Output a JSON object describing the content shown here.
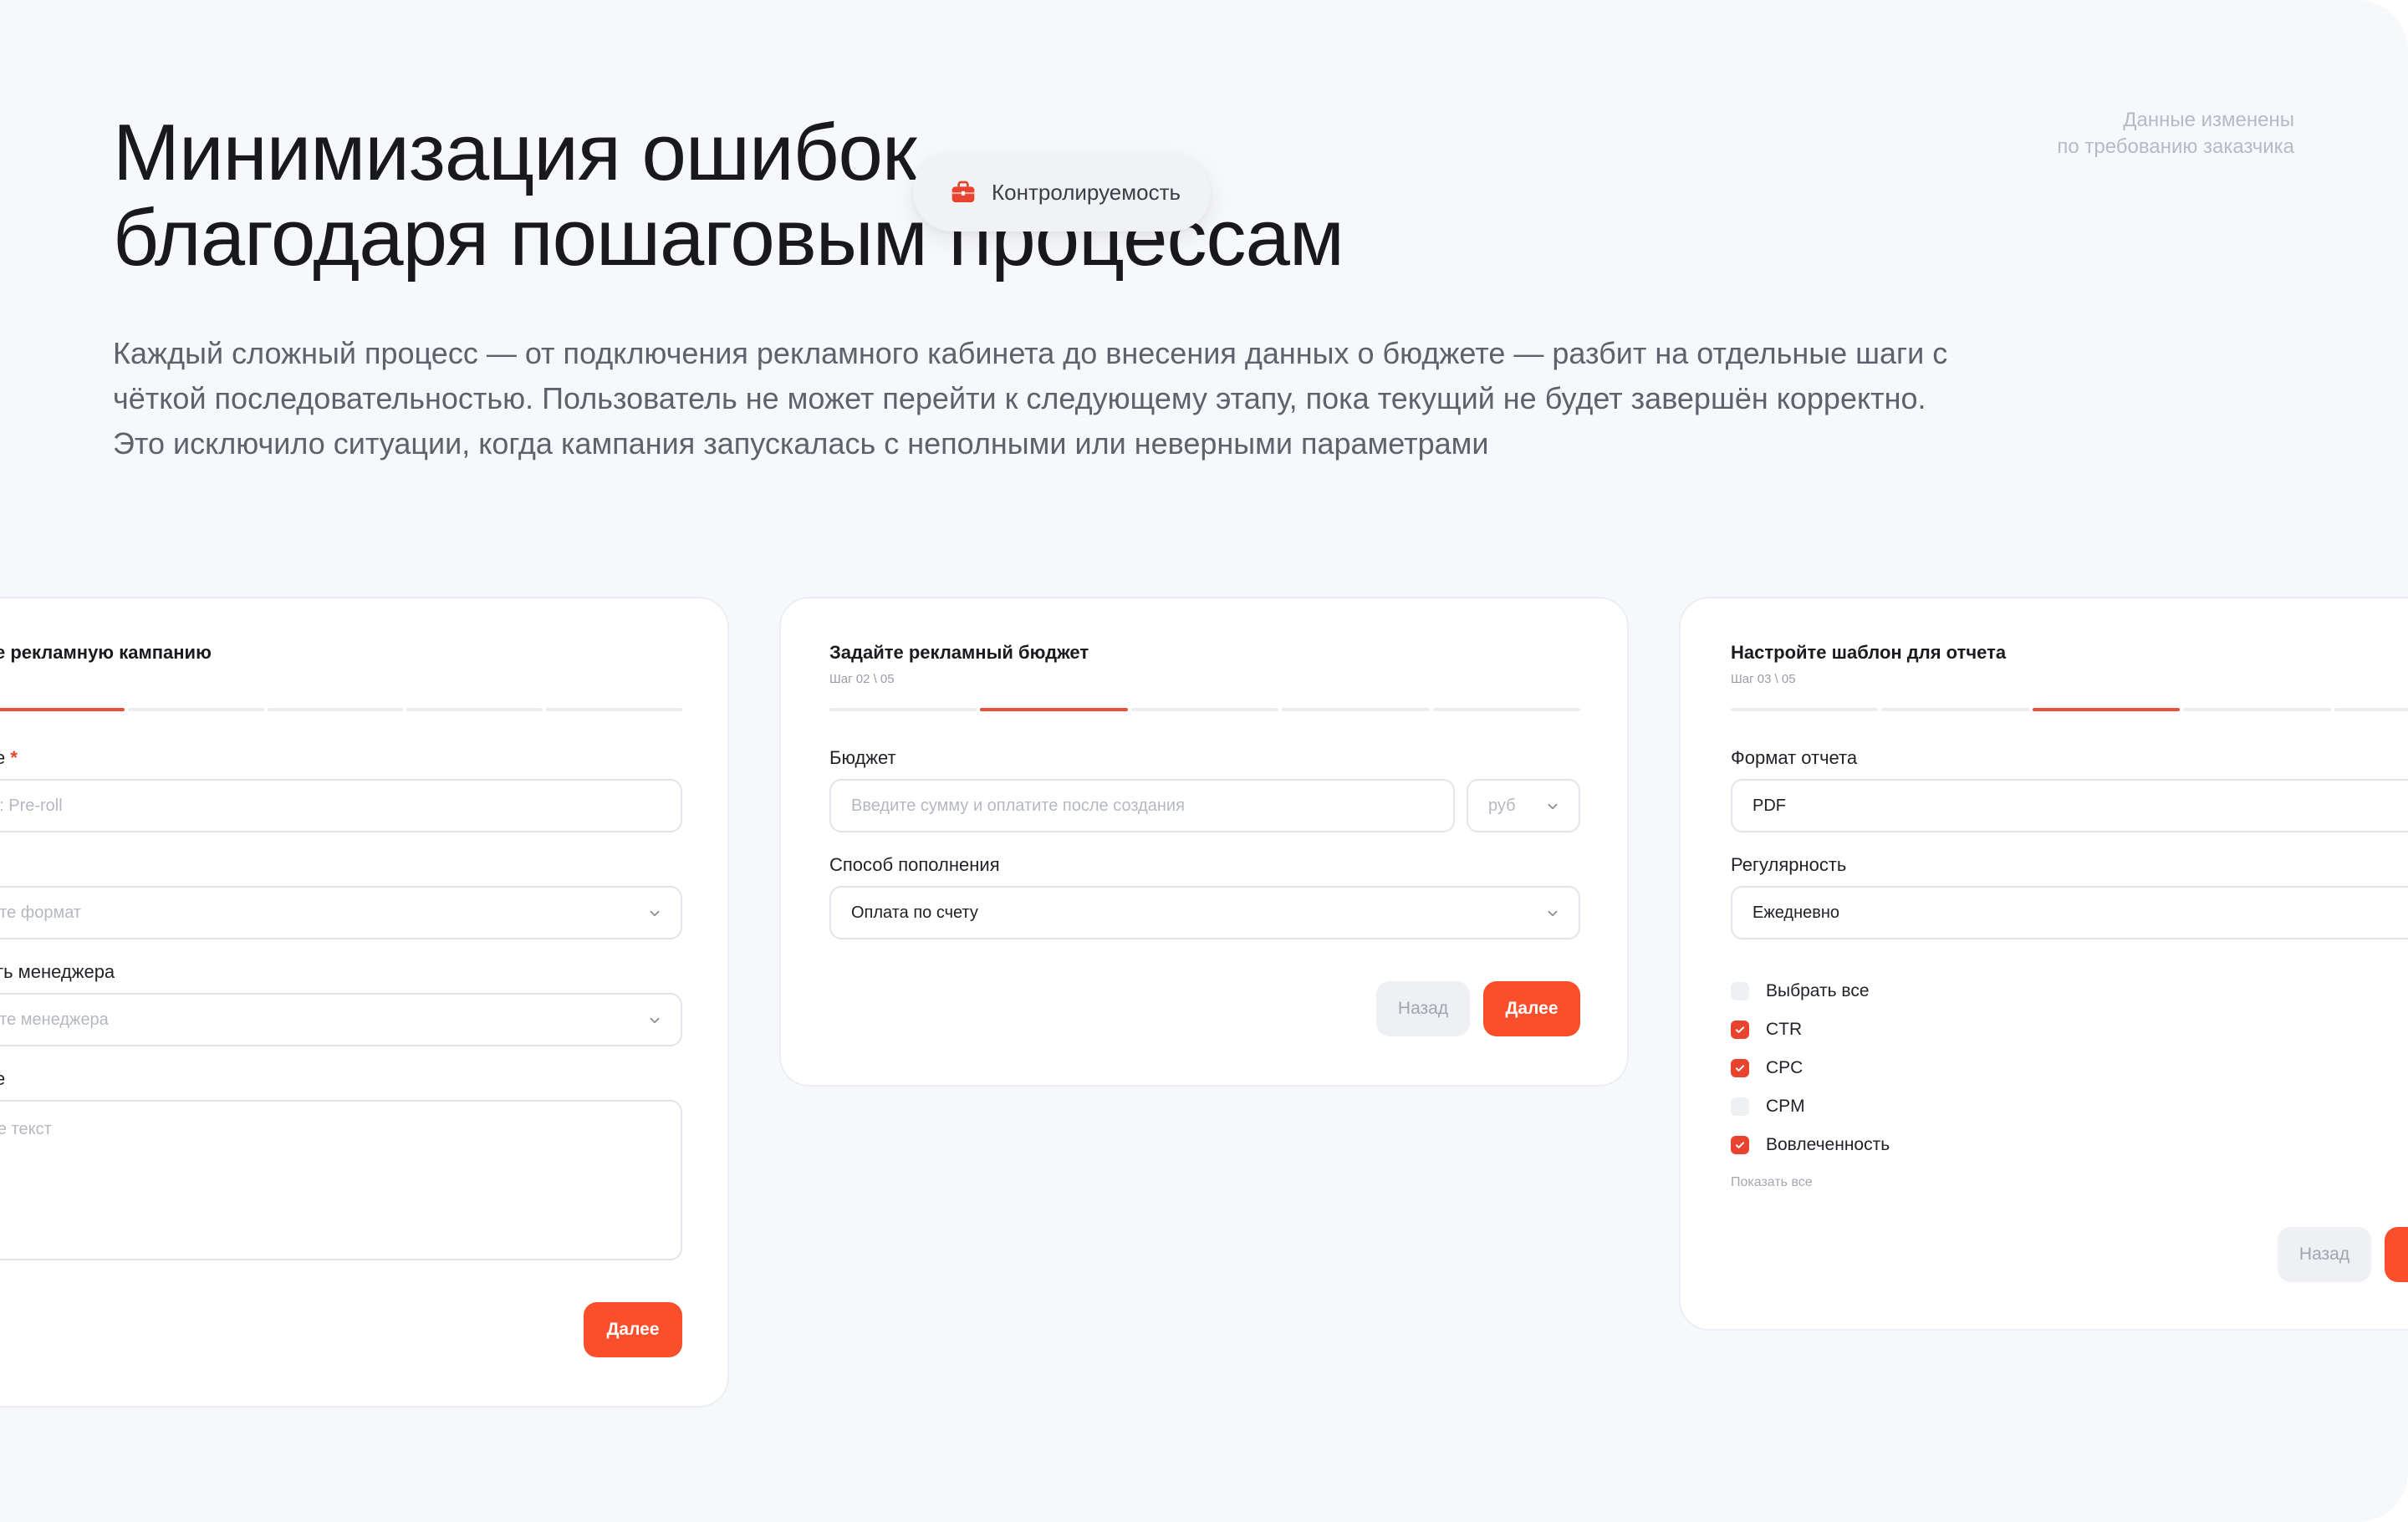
{
  "heading": {
    "line1": "Минимизация ошибок",
    "line2": "благодаря пошаговым процессам"
  },
  "tag": {
    "label": "Контролируемость",
    "icon": "briefcase-icon",
    "icon_color": "#e8432e"
  },
  "note": {
    "line1": "Данные изменены",
    "line2": "по требованию заказчика"
  },
  "lead": "Каждый сложный процесс — от подключения рекламного кабинета до внесения данных о бюджете — разбит на отдельные шаги с чёткой последовательностью. Пользователь не может перейти к следующему этапу, пока текущий не будет завершён корректно. Это исключило ситуации, когда кампания запускалась с неполными или неверными параметрами",
  "cards": {
    "campaign": {
      "title": "е рекламную кампанию",
      "name_label": "е",
      "name_placeholder": "р: Pre-roll",
      "format_placeholder": "ите формат",
      "manager_label": "ть менеджера",
      "manager_placeholder": "ите менеджера",
      "comment_label": "е",
      "comment_placeholder": "те текст",
      "next_label": "Далее",
      "active_step": 1
    },
    "budget": {
      "title": "Задайте рекламный бюджет",
      "step": "Шаг 02 \\ 05",
      "budget_label": "Бюджет",
      "budget_placeholder": "Введите сумму и оплатите после создания",
      "currency": "руб",
      "method_label": "Способ пополнения",
      "method_value": "Оплата по счету",
      "back_label": "Назад",
      "next_label": "Далее",
      "active_step": 2
    },
    "report": {
      "title": "Настройте шаблон для отчета",
      "step": "Шаг 03 \\ 05",
      "format_label": "Формат отчета",
      "format_value": "PDF",
      "regularity_label": "Регулярность",
      "regularity_value": "Ежедневно",
      "metrics": [
        {
          "label": "Выбрать все",
          "checked": false
        },
        {
          "label": "CTR",
          "checked": true
        },
        {
          "label": "CPC",
          "checked": true
        },
        {
          "label": "CPM",
          "checked": false
        },
        {
          "label": "Вовлеченность",
          "checked": true
        }
      ],
      "show_all": "Показать все",
      "back_label": "Назад",
      "active_step": 3
    }
  },
  "colors": {
    "accent": "#fb4f2c",
    "check": "#e8432e",
    "background": "#f7f8fb"
  }
}
